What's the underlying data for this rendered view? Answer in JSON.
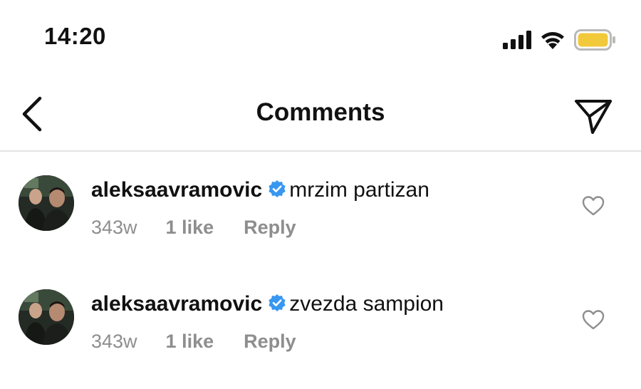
{
  "status_bar": {
    "time": "14:20",
    "signal_icon": "cellular-signal-icon",
    "wifi_icon": "wifi-icon",
    "battery_icon": "battery-icon",
    "battery_color": "#f2c93b"
  },
  "header": {
    "title": "Comments",
    "back_icon": "chevron-left-icon",
    "send_icon": "paper-plane-icon"
  },
  "comments": [
    {
      "username": "aleksaavramovic",
      "verified": true,
      "text": "mrzim partizan",
      "age": "343w",
      "likes": "1 like",
      "reply_label": "Reply",
      "like_icon": "heart-outline-icon"
    },
    {
      "username": "aleksaavramovic",
      "verified": true,
      "text": "zvezda sampion",
      "age": "343w",
      "likes": "1 like",
      "reply_label": "Reply",
      "like_icon": "heart-outline-icon"
    }
  ],
  "colors": {
    "verified_badge": "#3897f0",
    "muted_text": "#8e8e8e",
    "divider": "#e3e3e3"
  }
}
